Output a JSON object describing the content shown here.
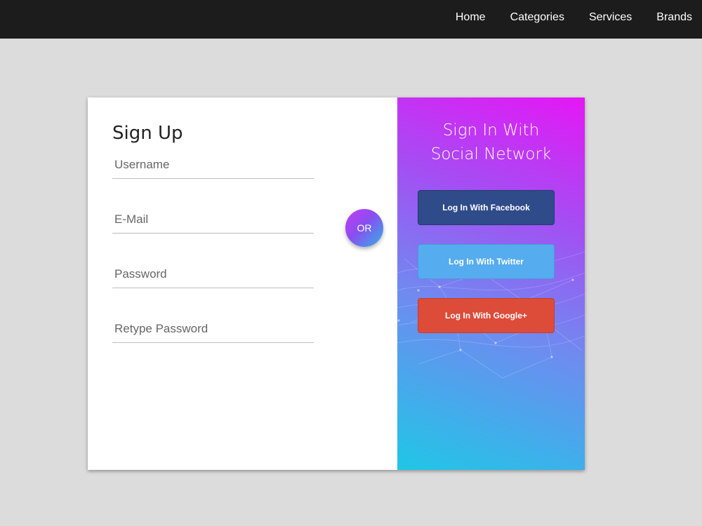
{
  "nav": {
    "items": [
      "Home",
      "Categories",
      "Services",
      "Brands"
    ]
  },
  "signup": {
    "title": "Sign Up",
    "fields": {
      "username": "Username",
      "email": "E-Mail",
      "password": "Password",
      "retype_password": "Retype Password"
    }
  },
  "divider": {
    "label": "OR"
  },
  "social": {
    "title_line1": "Sign In With",
    "title_line2": "Social Network",
    "facebook_label": "Log In With Facebook",
    "twitter_label": "Log In With Twitter",
    "google_label": "Log In With Google+"
  },
  "colors": {
    "topbar": "#1c1c1c",
    "background": "#dcdcdc",
    "facebook": "#2f4b8a",
    "twitter": "#55acee",
    "google": "#dd4b39",
    "gradient_start": "#e517f5",
    "gradient_end": "#20c6e6"
  }
}
